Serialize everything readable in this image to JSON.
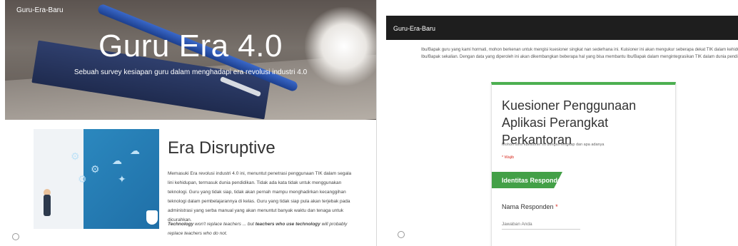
{
  "left": {
    "brand": "Guru-Era-Baru",
    "hero_title": "Guru Era 4.0",
    "hero_subtitle": "Sebuah survey kesiapan guru dalam menghadapi era revolusi industri 4.0",
    "section_title": "Era Disruptive",
    "section_body": "Memasuki Era revolusi industri 4.0 ini, menuntut penetrasi penggunaan TIK dalam segala lini kehidupan, termasuk dunia pendidikan. Tidak ada kata tidak untuk menggunakan teknologi. Guru yang tidak siap, tidak akan pernah mampu menghadirkan kecanggihan teknologi dalam pembelajarannya di kelas. Guru yang tidak siap pula akan terjebak pada administrasi yang serba manual yang akan menuntut banyak waktu dan tenaga untuk dicurahkan.",
    "quote_part1": "Technology",
    "quote_part2": " won't replace teachers ... but ",
    "quote_part3": "teachers who use technology",
    "quote_part4": " will probably replace teachers who do not."
  },
  "right": {
    "brand": "Guru-Era-Baru",
    "intro_line1": "Ibu/Bapak guru yang kami hormati, mohon berkenan untuk mengisi kuesioner singkat nan sederhana ini. Kuisioner ini akan mengukur seberapa dekat TIK dalam kehidupa",
    "intro_line2": "Ibu/Bapak sekalian. Dengan data yang diperoleh ini akan dikembangkan beberapa hal yang bisa membantu Ibu/Bapak dalam mengintegrasikan TIK dalam dunia pendidika",
    "form_title": "Kuesioner Penggunaan Aplikasi Perangkat Perkantoran",
    "form_description": "Mohon form kuesioner ini dengan lengkap dan apa adanya",
    "required_note": "* Wajib",
    "section_label": "Identitas Responden",
    "field_label": "Nama Responden",
    "field_required": "*",
    "field_placeholder": "Jawaban Anda"
  },
  "colors": {
    "accent_green": "#43a047",
    "required_red": "#d93025",
    "topbar": "#1e1e1e"
  }
}
